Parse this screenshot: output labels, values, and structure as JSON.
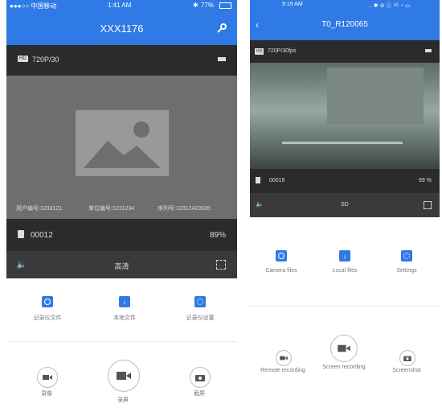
{
  "left_phone": {
    "status": {
      "carrier": "●●●○○ 中国移动",
      "time": "1:41 AM",
      "battery": "77%"
    },
    "title": "XXX1176",
    "resolution_badge": "HD",
    "resolution": "720P/30",
    "overlay": {
      "user_id": "用户编号:1233121",
      "unit_id": "单位编号:1231234",
      "serial": "序列号:12312423535"
    },
    "file_count": "00012",
    "storage_percent": "89%",
    "quality": "高清",
    "actions": [
      {
        "label": "记录仪文件",
        "icon": "recorder-files-icon"
      },
      {
        "label": "本地文件",
        "icon": "local-files-icon"
      },
      {
        "label": "记录仪设置",
        "icon": "recorder-settings-icon"
      }
    ],
    "controls": [
      {
        "label": "录像",
        "icon": "video-icon"
      },
      {
        "label": "录屏",
        "icon": "screen-record-icon"
      },
      {
        "label": "截屏",
        "icon": "camera-icon"
      }
    ]
  },
  "right_phone": {
    "status": {
      "time": "9:19 AM",
      "icons": "... ✱ ⊘ ⓒ ⁴ᴳ ◔ ▭"
    },
    "title": "T0_R120065",
    "resolution_badge": "HD",
    "resolution": "720P/30fps",
    "file_count": "00016",
    "storage_percent": "99 %",
    "quality": "SD",
    "actions": [
      {
        "label": "Camera files",
        "icon": "camera-files-icon"
      },
      {
        "label": "Local files",
        "icon": "local-files-icon"
      },
      {
        "label": "Settings",
        "icon": "settings-icon"
      }
    ],
    "controls": [
      {
        "label": "Remote recording",
        "icon": "video-icon"
      },
      {
        "label": "Screen recording",
        "icon": "screen-record-icon"
      },
      {
        "label": "Screenshot",
        "icon": "camera-icon"
      }
    ]
  },
  "colors": {
    "brand_blue": "#2f7ae5",
    "dark_bar": "#2b2b2b",
    "video_gray": "#6e6e6e"
  }
}
